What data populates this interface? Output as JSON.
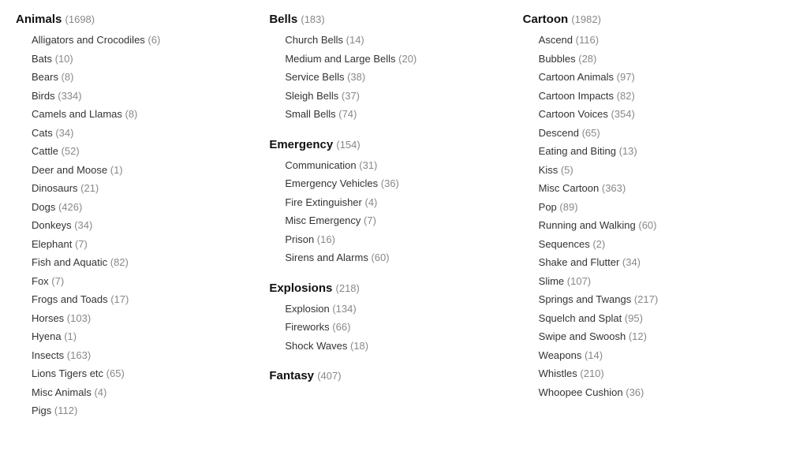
{
  "columns": [
    {
      "id": "animals",
      "title": "Animals",
      "count": 1698,
      "subcategories": [
        {
          "name": "Alligators and Crocodiles",
          "count": 6
        },
        {
          "name": "Bats",
          "count": 10
        },
        {
          "name": "Bears",
          "count": 8
        },
        {
          "name": "Birds",
          "count": 334
        },
        {
          "name": "Camels and Llamas",
          "count": 8
        },
        {
          "name": "Cats",
          "count": 34
        },
        {
          "name": "Cattle",
          "count": 52
        },
        {
          "name": "Deer and Moose",
          "count": 1
        },
        {
          "name": "Dinosaurs",
          "count": 21
        },
        {
          "name": "Dogs",
          "count": 426
        },
        {
          "name": "Donkeys",
          "count": 34
        },
        {
          "name": "Elephant",
          "count": 7
        },
        {
          "name": "Fish and Aquatic",
          "count": 82
        },
        {
          "name": "Fox",
          "count": 7
        },
        {
          "name": "Frogs and Toads",
          "count": 17
        },
        {
          "name": "Horses",
          "count": 103
        },
        {
          "name": "Hyena",
          "count": 1
        },
        {
          "name": "Insects",
          "count": 163
        },
        {
          "name": "Lions Tigers etc",
          "count": 65
        },
        {
          "name": "Misc Animals",
          "count": 4
        },
        {
          "name": "Pigs",
          "count": 112
        }
      ]
    },
    {
      "id": "bells-emergency-explosions-fantasy",
      "sections": [
        {
          "title": "Bells",
          "count": 183,
          "subcategories": [
            {
              "name": "Church Bells",
              "count": 14
            },
            {
              "name": "Medium and Large Bells",
              "count": 20
            },
            {
              "name": "Service Bells",
              "count": 38
            },
            {
              "name": "Sleigh Bells",
              "count": 37
            },
            {
              "name": "Small Bells",
              "count": 74
            }
          ]
        },
        {
          "title": "Emergency",
          "count": 154,
          "subcategories": [
            {
              "name": "Communication",
              "count": 31
            },
            {
              "name": "Emergency Vehicles",
              "count": 36
            },
            {
              "name": "Fire Extinguisher",
              "count": 4
            },
            {
              "name": "Misc Emergency",
              "count": 7
            },
            {
              "name": "Prison",
              "count": 16
            },
            {
              "name": "Sirens and Alarms",
              "count": 60
            }
          ]
        },
        {
          "title": "Explosions",
          "count": 218,
          "subcategories": [
            {
              "name": "Explosion",
              "count": 134
            },
            {
              "name": "Fireworks",
              "count": 66
            },
            {
              "name": "Shock Waves",
              "count": 18
            }
          ]
        },
        {
          "title": "Fantasy",
          "count": 407,
          "subcategories": []
        }
      ]
    },
    {
      "id": "cartoon",
      "title": "Cartoon",
      "count": 1982,
      "subcategories": [
        {
          "name": "Ascend",
          "count": 116
        },
        {
          "name": "Bubbles",
          "count": 28
        },
        {
          "name": "Cartoon Animals",
          "count": 97
        },
        {
          "name": "Cartoon Impacts",
          "count": 82
        },
        {
          "name": "Cartoon Voices",
          "count": 354
        },
        {
          "name": "Descend",
          "count": 65
        },
        {
          "name": "Eating and Biting",
          "count": 13
        },
        {
          "name": "Kiss",
          "count": 5
        },
        {
          "name": "Misc Cartoon",
          "count": 363
        },
        {
          "name": "Pop",
          "count": 89
        },
        {
          "name": "Running and Walking",
          "count": 60
        },
        {
          "name": "Sequences",
          "count": 2
        },
        {
          "name": "Shake and Flutter",
          "count": 34
        },
        {
          "name": "Slime",
          "count": 107
        },
        {
          "name": "Springs and Twangs",
          "count": 217
        },
        {
          "name": "Squelch and Splat",
          "count": 95
        },
        {
          "name": "Swipe and Swoosh",
          "count": 12
        },
        {
          "name": "Weapons",
          "count": 14
        },
        {
          "name": "Whistles",
          "count": 210
        },
        {
          "name": "Whoopee Cushion",
          "count": 36
        }
      ]
    }
  ]
}
